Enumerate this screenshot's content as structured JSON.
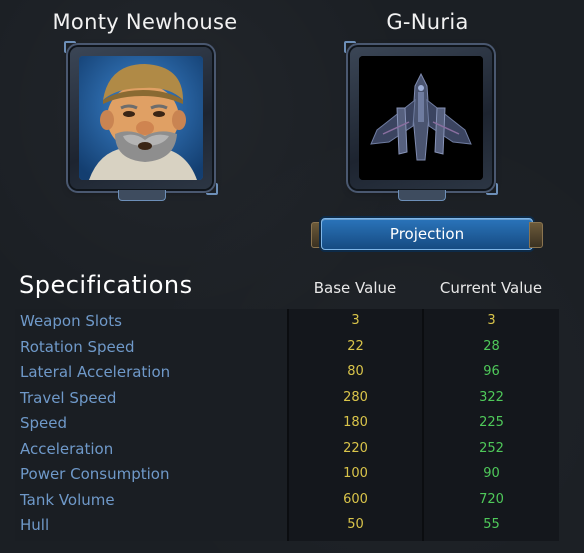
{
  "pilot": {
    "name": "Monty Newhouse"
  },
  "ship": {
    "name": "G-Nuria"
  },
  "projection_button": {
    "label": "Projection"
  },
  "specs": {
    "title": "Specifications",
    "base_header": "Base Value",
    "current_header": "Current Value",
    "colors": {
      "label": "#6f99c9",
      "base": "#d9c44a",
      "current_same": "#d9c44a",
      "current_better": "#4fc95a"
    },
    "rows": [
      {
        "label": "Weapon Slots",
        "base": "3",
        "current": "3",
        "state": "same"
      },
      {
        "label": "Rotation Speed",
        "base": "22",
        "current": "28",
        "state": "better"
      },
      {
        "label": "Lateral Acceleration",
        "base": "80",
        "current": "96",
        "state": "better"
      },
      {
        "label": "Travel Speed",
        "base": "280",
        "current": "322",
        "state": "better"
      },
      {
        "label": "Speed",
        "base": "180",
        "current": "225",
        "state": "better"
      },
      {
        "label": "Acceleration",
        "base": "220",
        "current": "252",
        "state": "better"
      },
      {
        "label": "Power Consumption",
        "base": "100",
        "current": "90",
        "state": "better"
      },
      {
        "label": "Tank Volume",
        "base": "600",
        "current": "720",
        "state": "better"
      },
      {
        "label": "Hull",
        "base": "50",
        "current": "55",
        "state": "better"
      }
    ]
  }
}
